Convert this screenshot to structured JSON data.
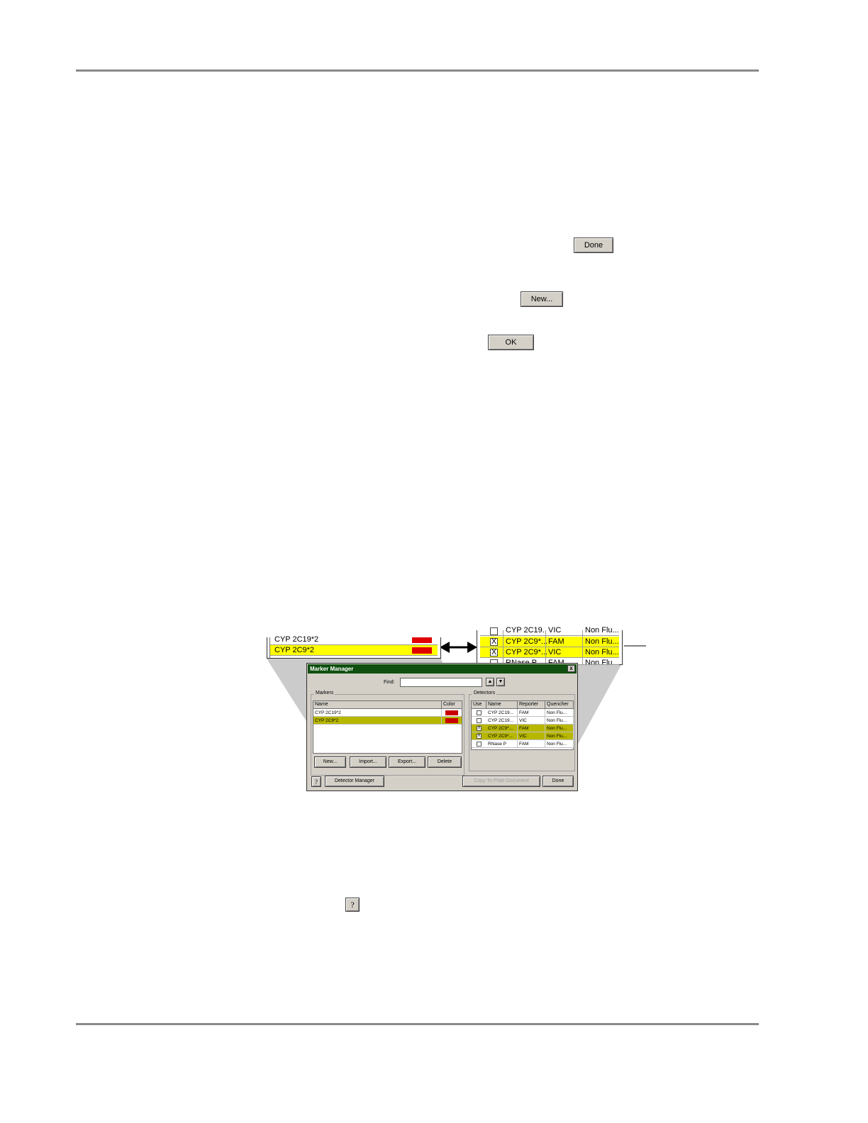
{
  "buttons": {
    "done": "Done",
    "new": "New...",
    "ok": "OK",
    "help": "?"
  },
  "zoom_markers": {
    "rows": [
      {
        "name": "CYP 2C19*2",
        "color": "#e00000",
        "selected": false
      },
      {
        "name": "CYP 2C9*2",
        "color": "#e00000",
        "selected": true
      }
    ]
  },
  "zoom_detectors": {
    "rows": [
      {
        "use": "",
        "name": "CYP 2C19...",
        "reporter": "VIC",
        "quencher": "Non Flu...",
        "selected": false
      },
      {
        "use": "X",
        "name": "CYP 2C9*...",
        "reporter": "FAM",
        "quencher": "Non Flu...",
        "selected": true
      },
      {
        "use": "X",
        "name": "CYP 2C9*...",
        "reporter": "VIC",
        "quencher": "Non Flu...",
        "selected": true
      },
      {
        "use": "",
        "name": "RNase P",
        "reporter": "FAM",
        "quencher": "Non Flu...",
        "selected": false
      }
    ]
  },
  "dialog": {
    "title": "Marker Manager",
    "close": "x",
    "find_label": "Find:",
    "find_value": "",
    "markers_group": "Markers",
    "markers_headers": [
      "Name",
      "Color"
    ],
    "markers": [
      {
        "name": "CYP 2C19*2",
        "color": "#c80000",
        "selected": false
      },
      {
        "name": "CYP 2C9*2",
        "color": "#c80000",
        "selected": true
      }
    ],
    "marker_buttons": [
      "New...",
      "Import...",
      "Export...",
      "Delete"
    ],
    "detectors_group": "Detectors",
    "detectors_headers": [
      "Use",
      "Name",
      "Reporter",
      "Quencher"
    ],
    "detectors": [
      {
        "use": "",
        "name": "CYP 2C19...",
        "reporter": "FAM",
        "quencher": "Non Flu...",
        "selected": false
      },
      {
        "use": "",
        "name": "CYP 2C19...",
        "reporter": "VIC",
        "quencher": "Non Flu...",
        "selected": false
      },
      {
        "use": "X",
        "name": "CYP 2C9*...",
        "reporter": "FAM",
        "quencher": "Non Flu...",
        "selected": true
      },
      {
        "use": "X",
        "name": "CYP 2C9*...",
        "reporter": "VIC",
        "quencher": "Non Flu...",
        "selected": true
      },
      {
        "use": "",
        "name": "RNase P",
        "reporter": "FAM",
        "quencher": "Non Flu...",
        "selected": false
      }
    ],
    "help_button": "?",
    "detector_manager_button": "Detector Manager",
    "copy_button": "Copy To Plate Document",
    "done_button": "Done"
  },
  "colors": {
    "highlight_zoom": "#ffff00",
    "highlight_dialog": "#b7b700",
    "titlebar": "#0f4f0f",
    "marker_color": "#c80000"
  }
}
